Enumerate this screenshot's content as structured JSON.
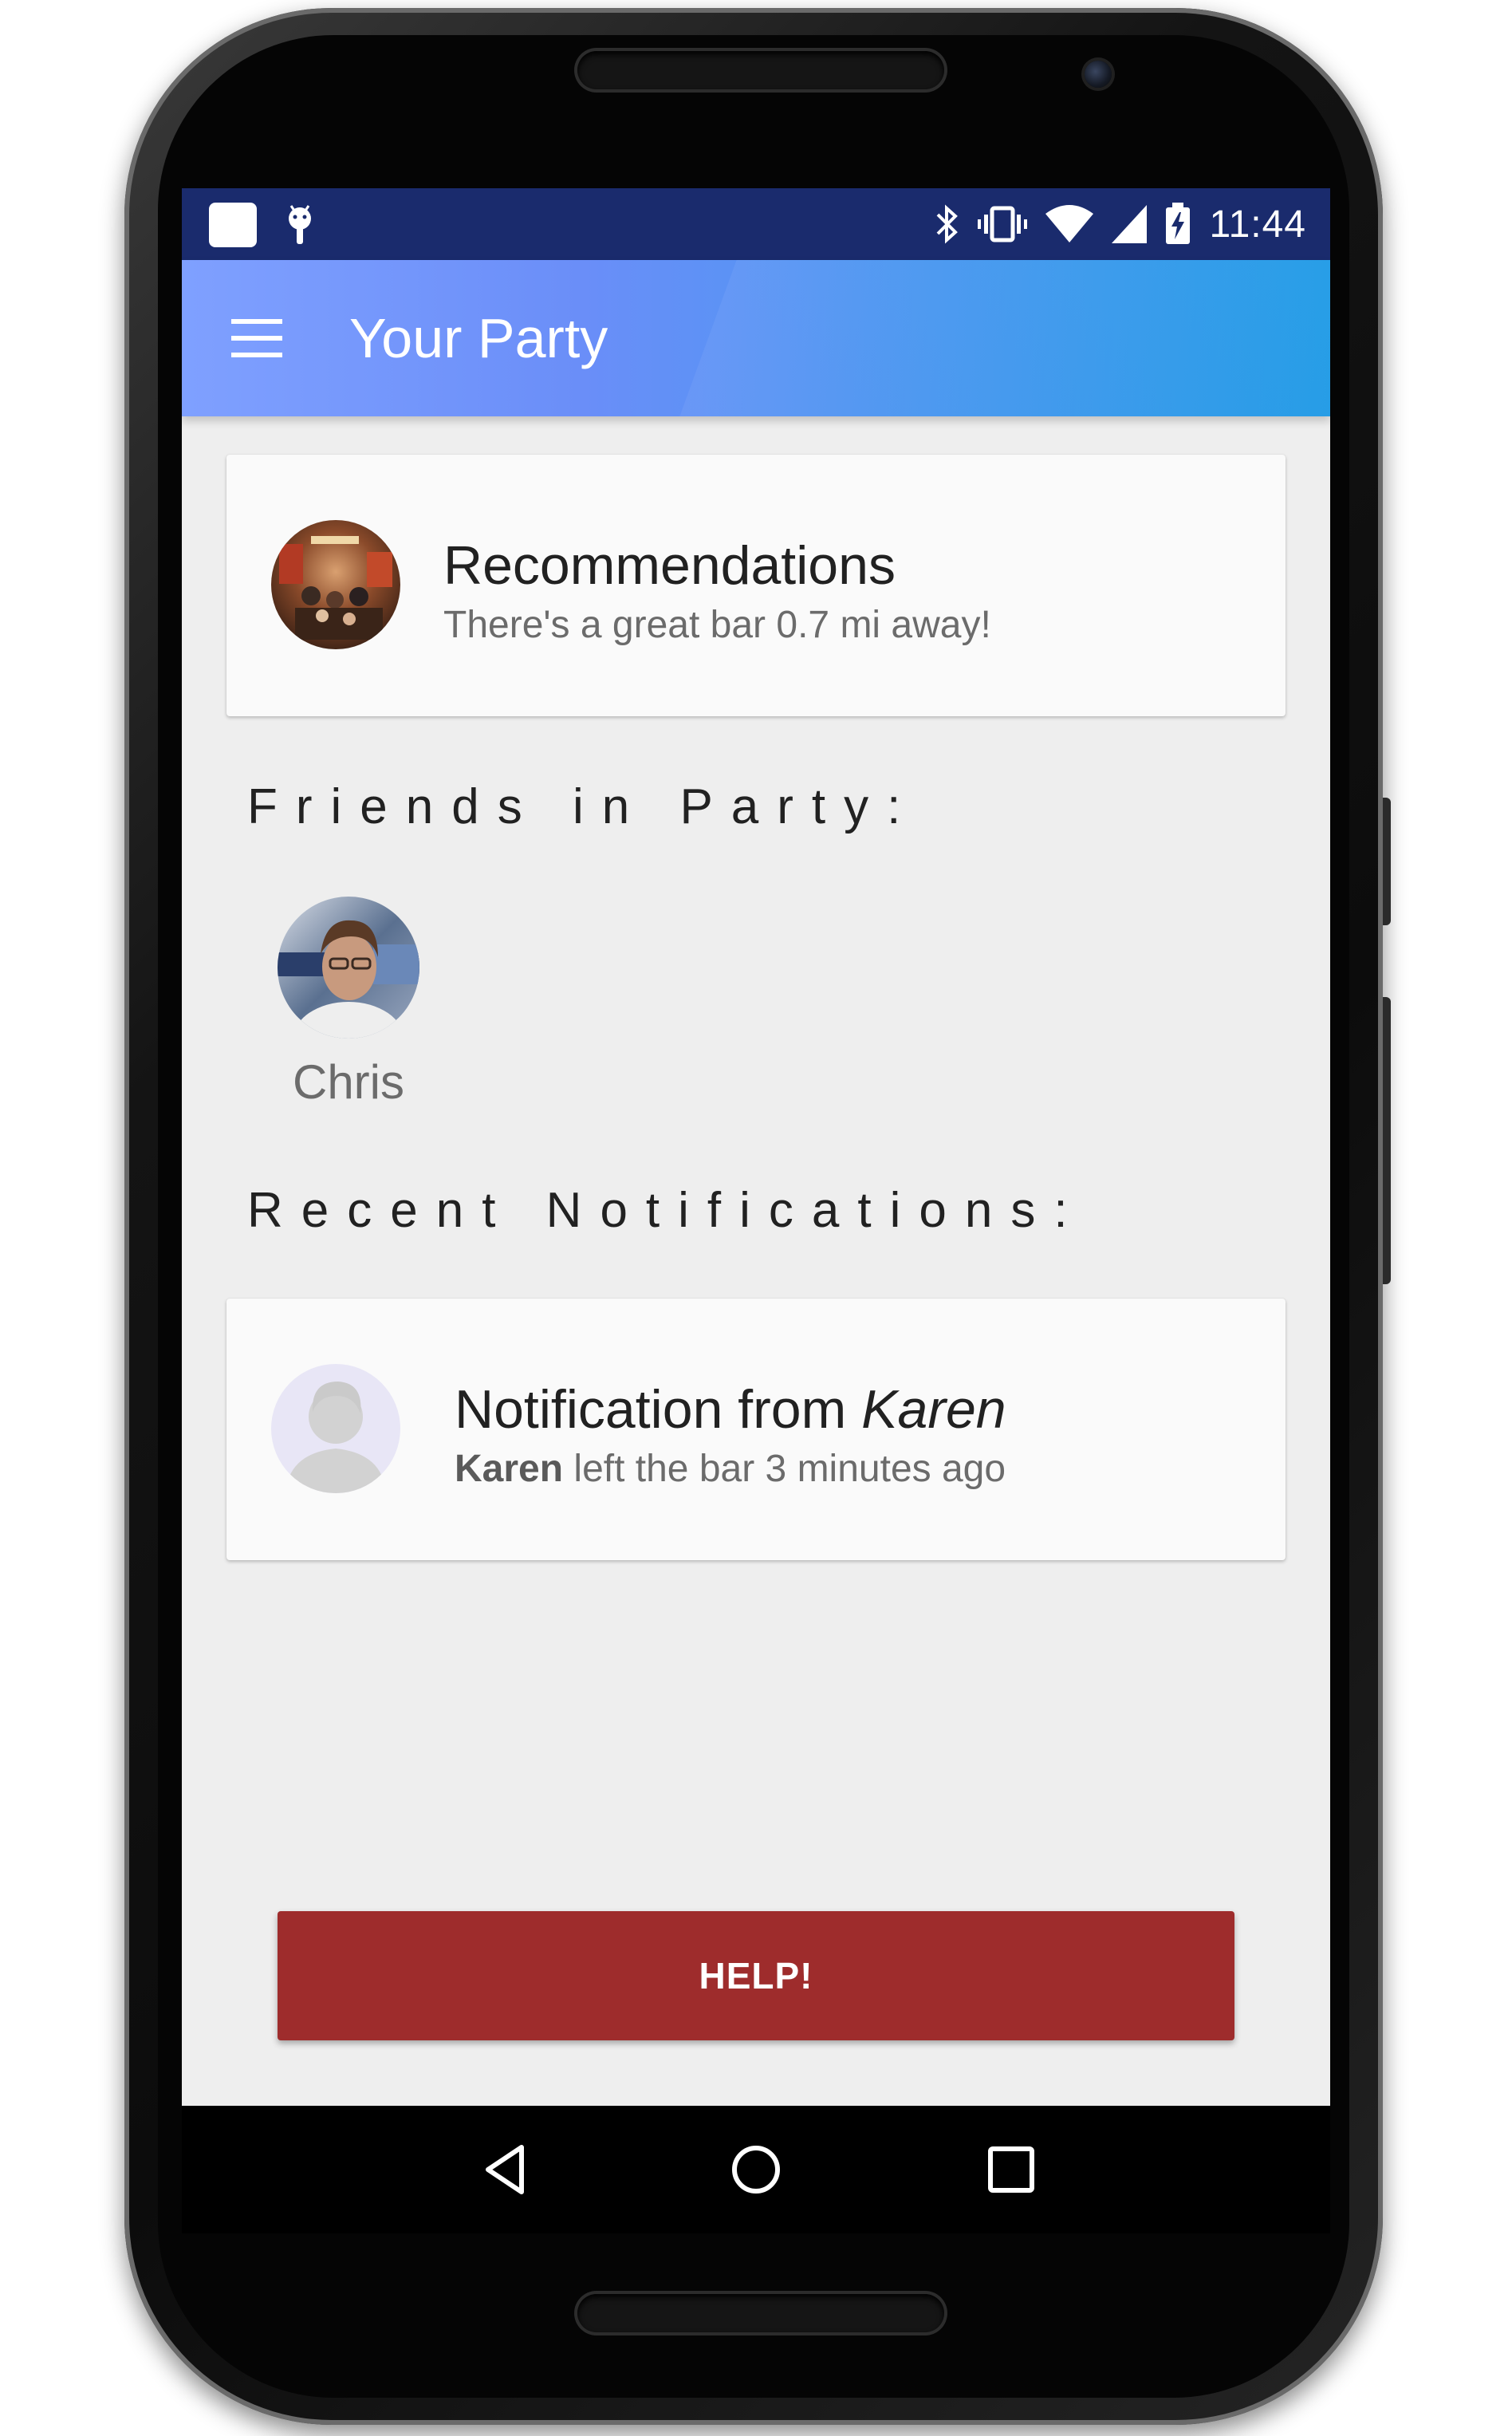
{
  "status_bar": {
    "time": "11:44",
    "left_icons": [
      "app-square-icon",
      "android-debug-icon"
    ],
    "right_icons": [
      "bluetooth-icon",
      "vibrate-icon",
      "wifi-icon",
      "signal-icon",
      "battery-charging-icon"
    ]
  },
  "app_bar": {
    "title": "Your Party",
    "menu_icon": "hamburger-menu-icon"
  },
  "recommendation_card": {
    "title": "Recommendations",
    "subtitle": "There's a great bar 0.7 mi away!",
    "image": "bar-photo-avatar"
  },
  "friends_section": {
    "header": "Friends in Party:",
    "friends": [
      {
        "name": "Chris",
        "image": "chris-photo-avatar"
      }
    ]
  },
  "notifications_section": {
    "header": "Recent Notifications:",
    "items": [
      {
        "title_prefix": "Notification from ",
        "title_name": "Karen",
        "sub_name": "Karen",
        "sub_text": " left the bar 3 minutes ago",
        "image": "default-person-avatar"
      }
    ]
  },
  "help_button": {
    "label": "HELP!",
    "color": "#9e2c2c"
  },
  "nav_bar": {
    "buttons": [
      "back-icon",
      "home-icon",
      "recents-icon"
    ]
  },
  "colors": {
    "status_bar": "#1a2b6d",
    "app_bar_start": "#7fa0ff",
    "app_bar_end": "#2aa6ea",
    "screen_bg": "#eeeeee",
    "card_bg": "#fafafa"
  }
}
